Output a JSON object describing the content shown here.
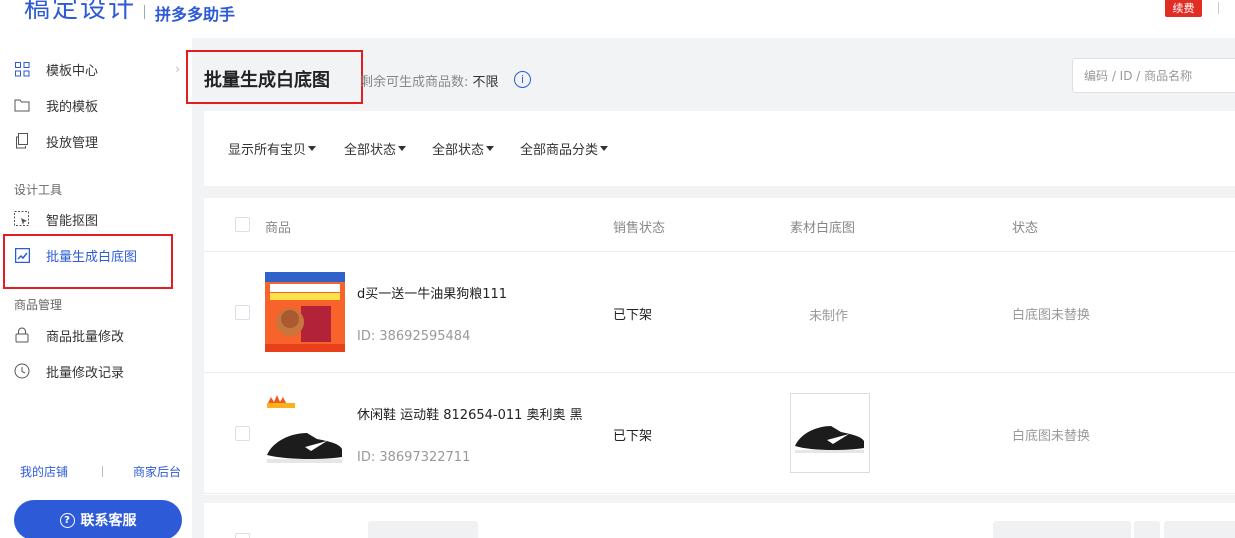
{
  "header": {
    "brand": "稿定设计",
    "product": "拼多多助手",
    "renew_label": "续费"
  },
  "sidebar": {
    "items": [
      {
        "label": "模板中心",
        "icon": "grid-icon"
      },
      {
        "label": "我的模板",
        "icon": "folder-icon"
      },
      {
        "label": "投放管理",
        "icon": "copy-icon"
      }
    ],
    "group_design": "设计工具",
    "design_items": [
      {
        "label": "智能抠图",
        "icon": "cutout-icon"
      },
      {
        "label": "批量生成白底图",
        "icon": "image-edit-icon"
      }
    ],
    "group_goods": "商品管理",
    "goods_items": [
      {
        "label": "商品批量修改",
        "icon": "lock-icon"
      },
      {
        "label": "批量修改记录",
        "icon": "clock-icon"
      }
    ],
    "link_shop": "我的店铺",
    "link_backend": "商家后台",
    "contact_label": "联系客服"
  },
  "main": {
    "title": "批量生成白底图",
    "quota_label": "剩余可生成商品数:",
    "quota_value": "不限",
    "search_placeholder": "编码 / ID / 商品名称"
  },
  "filters": [
    "显示所有宝贝",
    "全部状态",
    "全部状态",
    "全部商品分类"
  ],
  "table": {
    "columns": [
      "商品",
      "销售状态",
      "素材白底图",
      "状态"
    ],
    "rows": [
      {
        "name": "d买一送一牛油果狗粮111",
        "id": "ID: 38692595484",
        "sale_status": "已下架",
        "material": "未制作",
        "status": "白底图未替换"
      },
      {
        "name": "休闲鞋 运动鞋 812654-011 奥利奥 黑",
        "id": "ID: 38697322711",
        "sale_status": "已下架",
        "material": "",
        "status": "白底图未替换"
      }
    ]
  },
  "colors": {
    "accent": "#2d5bd7",
    "highlight_box": "#e02020",
    "renew": "#e02e24"
  }
}
